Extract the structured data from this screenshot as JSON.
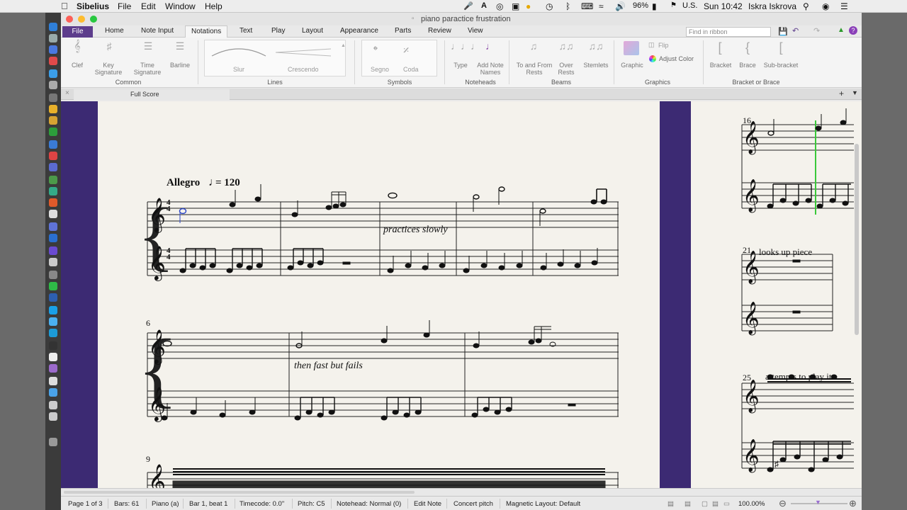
{
  "menubar": {
    "app_name": "Sibelius",
    "menus": [
      "File",
      "Edit",
      "Window",
      "Help"
    ],
    "battery": "96%",
    "input_source": "U.S.",
    "clock": "Sun 10:42",
    "user": "Iskra Iskrova"
  },
  "window": {
    "title": "piano paractice frustration"
  },
  "ribbon": {
    "file_tab": "File",
    "tabs": [
      "Home",
      "Note Input",
      "Notations",
      "Text",
      "Play",
      "Layout",
      "Appearance",
      "Parts",
      "Review",
      "View"
    ],
    "active_tab": "Notations",
    "find_placeholder": "Find in ribbon",
    "groups": {
      "common": {
        "label": "Common",
        "buttons": [
          "Clef",
          "Key Signature",
          "Time Signature",
          "Barline"
        ]
      },
      "lines": {
        "label": "Lines",
        "items": [
          "Slur",
          "Crescendo"
        ]
      },
      "symbols": {
        "label": "Symbols",
        "items": [
          "Segno",
          "Coda"
        ]
      },
      "noteheads": {
        "label": "Noteheads",
        "buttons": [
          "Type",
          "Add Note Names"
        ]
      },
      "beams": {
        "label": "Beams",
        "buttons": [
          "To and From Rests",
          "Over Rests",
          "Stemlets"
        ]
      },
      "graphics": {
        "label": "Graphics",
        "buttons": [
          "Graphic",
          "Flip",
          "Adjust Color"
        ]
      },
      "bracket": {
        "label": "Bracket or Brace",
        "buttons": [
          "Bracket",
          "Brace",
          "Sub-bracket"
        ]
      }
    }
  },
  "doc_tab": {
    "label": "Full Score"
  },
  "score": {
    "tempo_word": "Allegro",
    "tempo_value": "= 120",
    "time_sig": "4",
    "system1_texts": [
      "practices slowly"
    ],
    "system2_number": "6",
    "system2_texts": [
      "then fast but fails"
    ],
    "system3_number": "9",
    "right_page": {
      "s1_number": "16",
      "s2_number": "21",
      "s2_text": "looks up piece",
      "s3_number": "25",
      "s3_text": "attempts to play it"
    }
  },
  "status_bar": {
    "page": "Page 1 of 3",
    "bars": "Bars: 61",
    "instrument": "Piano (a)",
    "position": "Bar 1, beat 1",
    "timecode": "Timecode: 0.0\"",
    "pitch": "Pitch: C5",
    "notehead": "Notehead: Normal (0)",
    "mode": "Edit Note",
    "concert_pitch": "Concert pitch",
    "magnetic_layout": "Magnetic Layout: Default",
    "zoom": "100.00%"
  },
  "colors": {
    "file_tab": "#5d3d8c",
    "score_margin": "#3c2a73",
    "paper": "#f4f2ec",
    "playback_line": "#39c839",
    "selected_note": "#2b46c9"
  }
}
